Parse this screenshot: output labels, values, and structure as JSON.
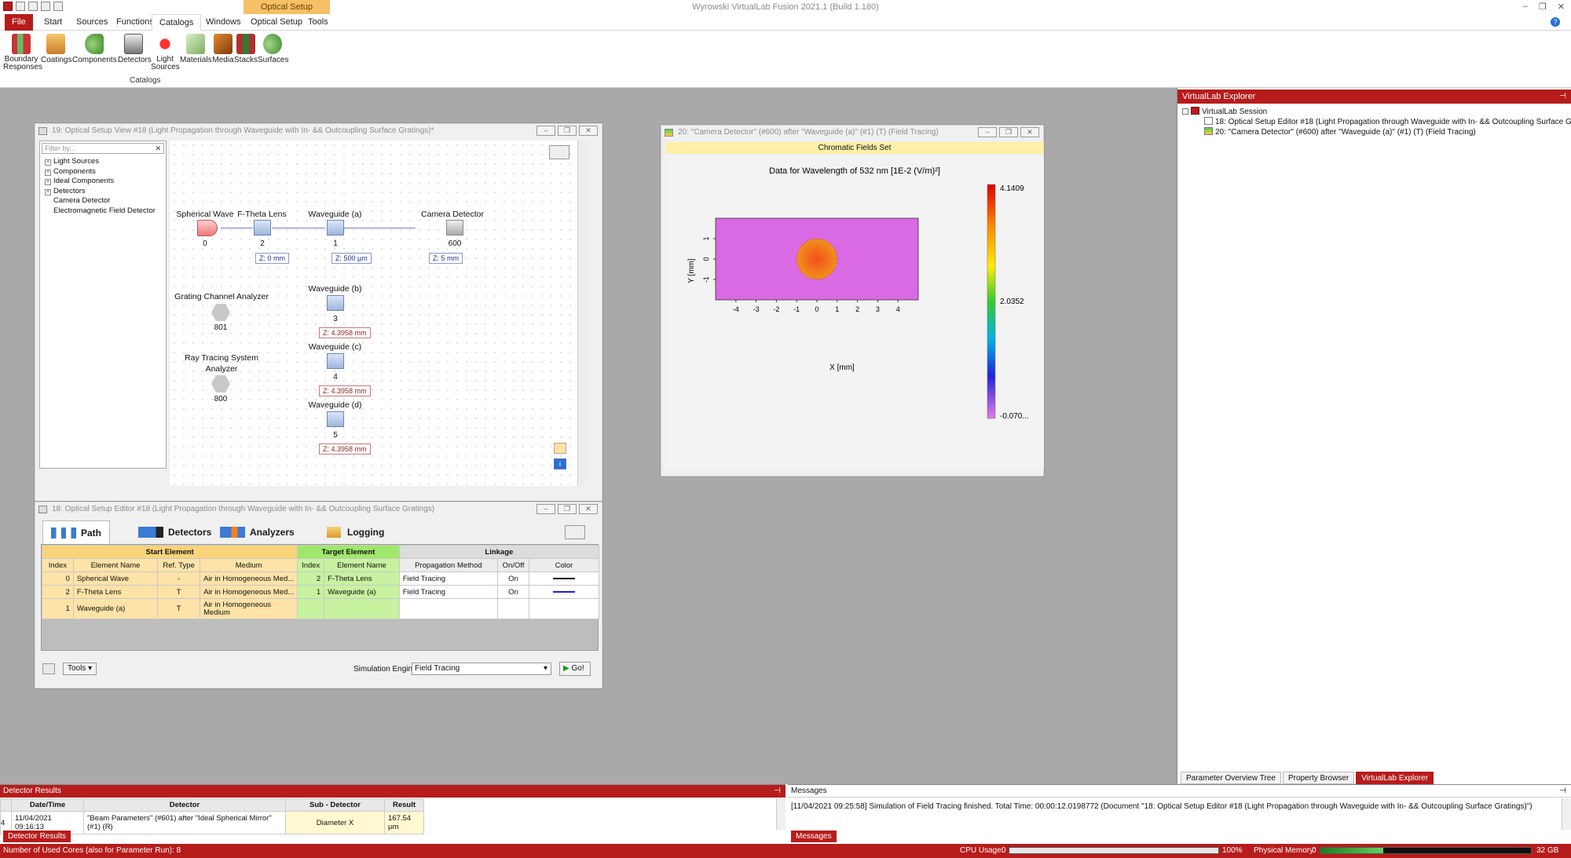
{
  "app": {
    "title": "Wyrowski VirtualLab Fusion 2021.1 (Build 1.180)",
    "context_tab_group": "Optical Setup"
  },
  "window_controls": {
    "minimize": "–",
    "restore": "❐",
    "close": "✕"
  },
  "ribbon": {
    "tabs": [
      "File",
      "Start",
      "Sources",
      "Functions",
      "Catalogs",
      "Windows",
      "Optical Setup",
      "Tools"
    ],
    "active_tab": "Catalogs",
    "group_label": "Catalogs",
    "buttons": [
      "Boundary\nResponses",
      "Coatings",
      "Components",
      "Detectors",
      "Light\nSources",
      "Materials",
      "Media",
      "Stacks",
      "Surfaces"
    ]
  },
  "osv": {
    "title": "19: Optical Setup View #18 (Light Propagation through Waveguide with In- && Outcoupling Surface Gratings)*",
    "filter_placeholder": "Filter by...",
    "tree": [
      {
        "label": "Light Sources",
        "expandable": true
      },
      {
        "label": "Components",
        "expandable": true
      },
      {
        "label": "Ideal Components",
        "expandable": true
      },
      {
        "label": "Detectors",
        "expandable": true
      },
      {
        "label": "Camera Detector",
        "expandable": false
      },
      {
        "label": "Electromagnetic Field Detector",
        "expandable": false
      }
    ],
    "nodes": {
      "spherical_wave": {
        "label": "Spherical Wave",
        "index": "0"
      },
      "ftheta": {
        "label": "F-Theta Lens",
        "index": "2",
        "z": "Z: 0 mm"
      },
      "wg_a": {
        "label": "Waveguide (a)",
        "index": "1",
        "z": "Z: 500 µm"
      },
      "camera": {
        "label": "Camera Detector",
        "index": "600",
        "z": "Z: 5 mm"
      },
      "gca": {
        "label": "Grating Channel Analyzer",
        "index": "801"
      },
      "rtsa": {
        "label": "Ray Tracing System\nAnalyzer",
        "index": "800"
      },
      "wg_b": {
        "label": "Waveguide (b)",
        "index": "3",
        "z": "Z: 4.3958 mm"
      },
      "wg_c": {
        "label": "Waveguide (c)",
        "index": "4",
        "z": "Z: 4.3958 mm"
      },
      "wg_d": {
        "label": "Waveguide (d)",
        "index": "5",
        "z": "Z: 4.3958 mm"
      }
    }
  },
  "camera_window": {
    "title": "20: \"Camera Detector\" (#600) after \"Waveguide (a)\" (#1) (T) (Field Tracing)",
    "banner": "Chromatic Fields Set"
  },
  "chart_data": {
    "type": "heatmap",
    "title": "Data for Wavelength of 532 nm  [1E-2 (V/m)²]",
    "xlabel": "X [mm]",
    "ylabel": "Y [mm]",
    "x_ticks": [
      "-4",
      "-3",
      "-2",
      "-1",
      "0",
      "1",
      "2",
      "3",
      "4"
    ],
    "y_ticks": [
      "1",
      "0",
      "-1"
    ],
    "xlim": [
      -5,
      5
    ],
    "ylim": [
      -2,
      2
    ],
    "colorbar_labels": [
      "4.1409",
      "2.0352",
      "-0.070..."
    ],
    "color_range": [
      -0.07,
      4.1409
    ],
    "background_value": 0.0,
    "spot": {
      "center_x": 0,
      "center_y": 0,
      "radius_mm": 1.0,
      "value": 3.5
    },
    "colors": {
      "background": "#d96ae4",
      "spot": "#f07a1c"
    }
  },
  "editor": {
    "title": "18: Optical Setup Editor #18 (Light Propagation through Waveguide with In- && Outcoupling Surface Gratings)",
    "tabs": [
      "Path",
      "Detectors",
      "Analyzers",
      "Logging"
    ],
    "active_tab": "Path",
    "group_headers": [
      "Start Element",
      "Target Element",
      "Linkage"
    ],
    "columns": [
      "Index",
      "Element Name",
      "Ref. Type",
      "Medium",
      "Index",
      "Element Name",
      "Propagation Method",
      "On/Off",
      "Color"
    ],
    "rows": [
      {
        "idx": "0",
        "name": "Spherical Wave",
        "ref": "-",
        "medium": "Air in Homogeneous Med...",
        "tidx": "2",
        "tname": "F-Theta Lens",
        "method": "Field Tracing",
        "onoff": "On",
        "color": "#111111"
      },
      {
        "idx": "2",
        "name": "F-Theta Lens",
        "ref": "T",
        "medium": "Air in Homogeneous Med...",
        "tidx": "1",
        "tname": "Waveguide (a)",
        "method": "Field Tracing",
        "onoff": "On",
        "color": "#2020d0"
      },
      {
        "idx": "1",
        "name": "Waveguide (a)",
        "ref": "T",
        "medium": "Air in Homogeneous\nMedium",
        "tidx": "",
        "tname": "",
        "method": "",
        "onoff": "",
        "color": ""
      }
    ],
    "tools_label": "Tools",
    "sim_engine_label": "Simulation Engine",
    "sim_engine_value": "Field Tracing",
    "go_label": "Go!"
  },
  "explorer": {
    "title": "VirtualLab Explorer",
    "session": "VirtualLab Session",
    "items": [
      "18: Optical Setup Editor #18 (Light Propagation through Waveguide with In- && Outcoupling Surface Gratings)",
      "20: \"Camera Detector\" (#600) after \"Waveguide (a)\" (#1) (T) (Field Tracing)"
    ],
    "tabs": [
      "Parameter Overview Tree",
      "Property Browser",
      "VirtualLab Explorer"
    ],
    "active_tab": "VirtualLab Explorer"
  },
  "detector_results": {
    "title": "Detector Results",
    "columns": [
      "Date/Time",
      "Detector",
      "Sub - Detector",
      "Result"
    ],
    "row_number": "4",
    "rows": [
      {
        "datetime": "11/04/2021 09:16:13",
        "detector": "\"Beam Parameters\" (#601) after \"Ideal Spherical Mirror\" (#1) (R)",
        "sub": "Diameter X",
        "result": "167.54 µm"
      }
    ],
    "tab_label": "Detector Results"
  },
  "messages": {
    "title": "Messages",
    "text": "[11/04/2021 09:25:58] Simulation of Field Tracing finished. Total Time: 00:00:12.0198772 (Document \"18: Optical Setup Editor #18 (Light Propagation through Waveguide with In- && Outcoupling Surface Gratings)\")",
    "tab_label": "Messages"
  },
  "status": {
    "left": "Number of Used Cores (also for Parameter Run): 8",
    "cpu_label": "CPU Usage:",
    "cpu_min": "0",
    "cpu_max": "100%",
    "cpu_fraction": 0.0,
    "mem_label": "Physical Memory:",
    "mem_min": "0",
    "mem_max": "32 GB",
    "mem_fraction": 0.3
  }
}
